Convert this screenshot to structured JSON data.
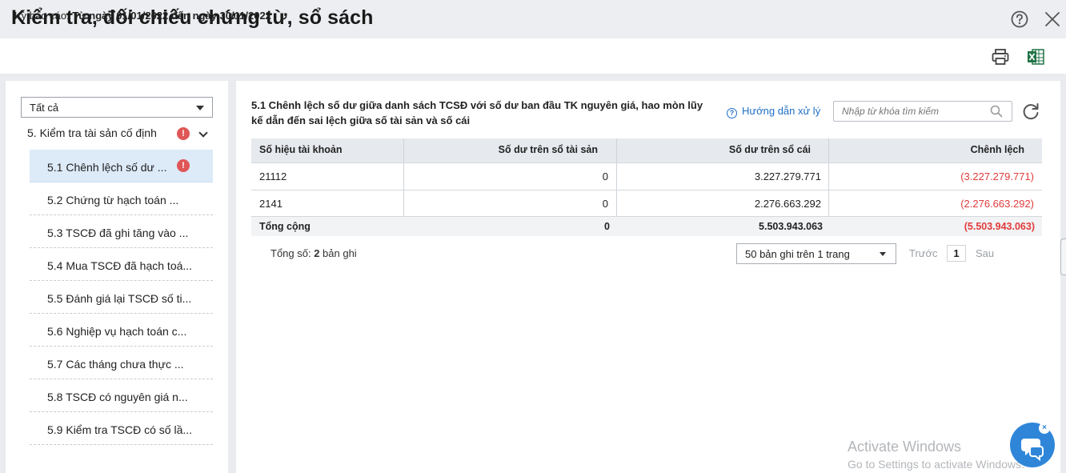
{
  "window": {
    "title": "Kiểm tra, đối chiếu chứng từ, sổ sách"
  },
  "period": {
    "label": "Kỳ báo cáo: ",
    "value": "Từ ngày 01/01/2022 đến ngày 30/11/2022"
  },
  "sidebar": {
    "filter_value": "Tất cả",
    "group_label": "5. Kiểm tra tài sản cố định",
    "alert_glyph": "!",
    "items": [
      {
        "label": "5.1 Chênh lệch số dư ..."
      },
      {
        "label": "5.2 Chứng từ hạch toán ..."
      },
      {
        "label": "5.3 TSCĐ đã ghi tăng vào ..."
      },
      {
        "label": "5.4 Mua TSCĐ đã hạch toá..."
      },
      {
        "label": "5.5 Đánh giá lại TSCĐ số ti..."
      },
      {
        "label": "5.6 Nghiệp vụ hạch toán c..."
      },
      {
        "label": "5.7 Các tháng chưa thực ..."
      },
      {
        "label": "5.8 TSCĐ có nguyên giá n..."
      },
      {
        "label": "5.9 Kiểm tra TSCĐ có số lầ..."
      }
    ]
  },
  "main": {
    "section_title": "5.1 Chênh lệch số dư giữa danh sách TCSĐ với số dư ban đầu TK nguyên giá, hao mòn lũy kế dẫn đến sai lệch giữa số tài sản và số cái",
    "guide_label": "Hướng dẫn xử lý",
    "guide_glyph": "?",
    "search_placeholder": "Nhập từ khóa tìm kiếm",
    "table": {
      "headers": [
        "Số hiệu tài khoản",
        "Số dư trên sổ tài sản",
        "Số dư trên sổ cái",
        "Chênh lệch"
      ],
      "rows": [
        [
          "21112",
          "0",
          "3.227.279.771",
          "(3.227.279.771)"
        ],
        [
          "2141",
          "0",
          "2.276.663.292",
          "(2.276.663.292)"
        ]
      ],
      "total": [
        "Tổng cộng",
        "0",
        "5.503.943.063",
        "(5.503.943.063)"
      ]
    },
    "pagination": {
      "count_prefix": "Tổng số: ",
      "count_value": "2",
      "count_suffix": " bản ghi",
      "page_size": "50 bản ghi trên 1 trang",
      "prev": "Trước",
      "page": "1",
      "next": "Sau"
    }
  },
  "watermark": {
    "line1": "Activate Windows",
    "line2": "Go to Settings to activate Windows."
  },
  "chat": {
    "close_glyph": "×"
  },
  "colors": {
    "accent": "#1f6fc5",
    "negative": "#e03b3b",
    "alert": "#e05656",
    "chat": "#2f86d9"
  }
}
